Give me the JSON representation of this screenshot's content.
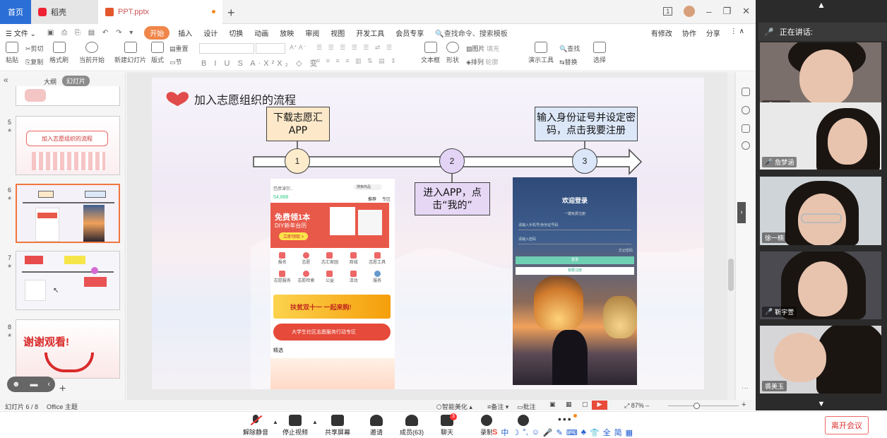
{
  "tabs": {
    "home": "首页",
    "wps": "稻壳",
    "file": "PPT.pptx",
    "add": "+"
  },
  "window": {
    "page_indicator": "1"
  },
  "menu": {
    "file": "文件",
    "items": [
      "开始",
      "插入",
      "设计",
      "切换",
      "动画",
      "放映",
      "审阅",
      "视图",
      "开发工具",
      "会员专享"
    ],
    "search": "查找命令、搜索模板",
    "right": [
      "有修改",
      "协作",
      "分享"
    ]
  },
  "ribbon": {
    "paste": "粘贴",
    "cut": "剪切",
    "copy": "复制",
    "format_painter": "格式刷",
    "from_current": "当前开始",
    "new_slide": "新建幻灯片",
    "layout": "版式",
    "reset": "重置",
    "section": "节",
    "textbox": "文本框",
    "shape": "形状",
    "picture": "图片",
    "arrange": "排列",
    "fill": "填充",
    "outline": "轮廓",
    "present_tools": "演示工具",
    "find": "查找",
    "replace": "替换",
    "select": "选择"
  },
  "leftpanel": {
    "outline_tab": "大纲",
    "slides_tab": "幻灯片",
    "thumbs": [
      {
        "num": "5",
        "text": "加入志愿组织的流程"
      },
      {
        "num": "6",
        "text": ""
      },
      {
        "num": "7",
        "text": ""
      },
      {
        "num": "8",
        "text": "谢谢观看!"
      }
    ]
  },
  "slide": {
    "title": "加入志愿组织的流程",
    "step1_box": "下载志愿汇 APP",
    "step2_box": "进入APP，点击“我的”",
    "step3_box": "输入身份证号并设定密码，点击我要注册",
    "circle1": "1",
    "circle2": "2",
    "circle3": "3",
    "phone1": {
      "location": "巴彦淖尔..",
      "search": "搜索商品",
      "score": "54,888",
      "tab_recommend": "推荐",
      "tab_area": "专区",
      "banner_title": "免费领1本",
      "banner_sub": "DIY新年台历",
      "banner_btn": "立即领取 >",
      "icons": [
        "报名",
        "志愿",
        "志汇家园",
        "商城",
        "志愿工具",
        "志愿服务",
        "志愿检索",
        "公益",
        "活动",
        "服务"
      ],
      "promo1": "扶贫双十一 一起来购!",
      "promo2": "大学生社区志愿服务行动专区",
      "section": "精选"
    },
    "phone2": {
      "title": "欢迎登录",
      "subtitle": "一键免费注册",
      "field1": "请输入手机号/身份证号码",
      "field2": "请输入密码",
      "forgot": "忘记密码",
      "login_btn": "登录",
      "register_btn": "我要注册"
    }
  },
  "status": {
    "slide_info": "幻灯片 6 / 8",
    "theme": "Office 主题",
    "beautify": "智能美化",
    "notes": "备注",
    "comments": "批注",
    "zoom": "87%"
  },
  "meeting": {
    "unmute": "解除静音",
    "stop_video": "停止视频",
    "share": "共享屏幕",
    "invite": "邀请",
    "members": "成员(63)",
    "chat": "聊天",
    "chat_badge": "3",
    "record": "录制",
    "leave": "离开会议"
  },
  "ime": [
    "S",
    "中",
    "☽",
    "°,",
    "☺",
    "🎤",
    "✎",
    "⌨",
    "♣",
    "👕",
    "全",
    "简",
    "▦"
  ],
  "videos": {
    "speaking_label": "正在讲话:",
    "participants": [
      {
        "name": "陈莹"
      },
      {
        "name": "詹梦涵"
      },
      {
        "name": "徐一楠"
      },
      {
        "name": "靳宇萱"
      },
      {
        "name": "裘美玉"
      }
    ]
  },
  "colors": {
    "accent": "#f0864a",
    "tab_blue": "#2b6fd6",
    "circle_yellow": "#fdeccc",
    "circle_purple": "#e3d4f5",
    "circle_blue": "#dbe6f8",
    "box_yellow": "#fde9c9",
    "box_purple": "#e6d7f5",
    "box_blue": "#dce7f8",
    "arrow_fill": "#ffffff"
  }
}
